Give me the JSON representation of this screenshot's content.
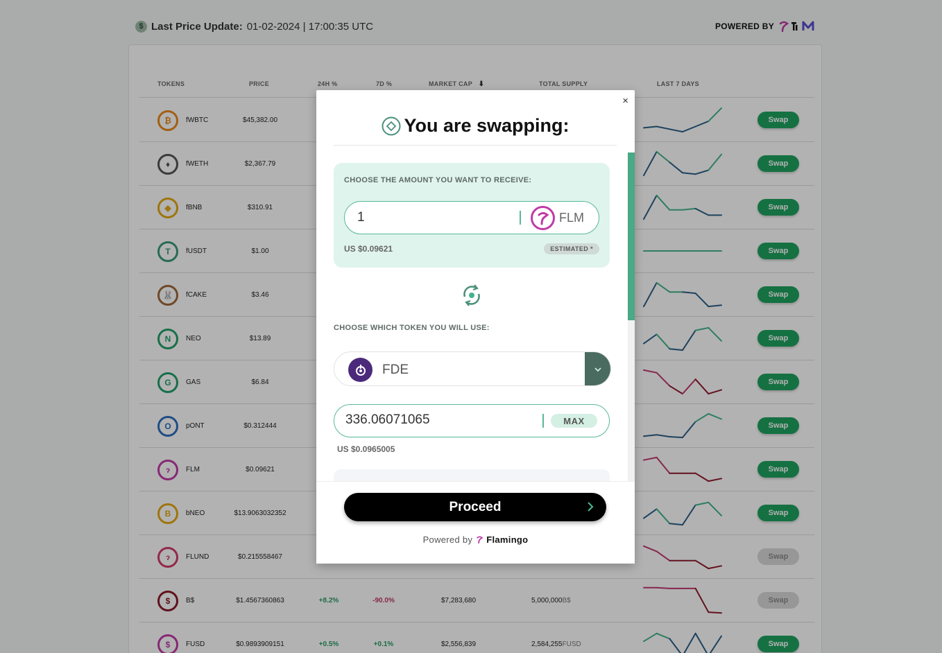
{
  "header": {
    "last_update_label": "Last Price Update:",
    "last_update_value": "01-02-2024 | 17:00:35 UTC",
    "powered_by": "POWERED BY"
  },
  "table": {
    "columns": [
      "TOKENS",
      "PRICE",
      "24H %",
      "7D %",
      "MARKET CAP",
      "TOTAL SUPPLY",
      "LAST 7 DAYS"
    ],
    "sort_indicator": "⬇",
    "swap_label": "Swap",
    "rows": [
      {
        "symbol": "fWBTC",
        "price": "$45,382.00",
        "h24": "",
        "d7": "",
        "mcap": "",
        "supply": "",
        "supply_unit": "",
        "icon": "bitcoin-icon",
        "glyph": "₿",
        "color": "#e8891c",
        "spark": [
          0.8,
          0.75,
          0.85,
          0.95,
          0.75,
          0.55,
          0.05
        ],
        "spark_colors": [
          "#2b5f87",
          "#2b5f87",
          "#2b5f87",
          "#2b5f87",
          "#2b5f87",
          "#43b38a"
        ],
        "swap_enabled": true
      },
      {
        "symbol": "fWETH",
        "price": "$2,367.79",
        "h24": "",
        "d7": "",
        "mcap": "",
        "supply": "",
        "supply_unit": "",
        "icon": "ethereum-icon",
        "glyph": "♦",
        "color": "#555555",
        "spark": [
          0.95,
          0.05,
          0.45,
          0.85,
          0.9,
          0.75,
          0.15
        ],
        "spark_colors": [
          "#2b5f87",
          "#43b38a",
          "#2b5f87",
          "#2b5f87",
          "#2b5f87",
          "#43b38a"
        ],
        "swap_enabled": true
      },
      {
        "symbol": "fBNB",
        "price": "$310.91",
        "h24": "",
        "d7": "",
        "mcap": "",
        "supply": "",
        "supply_unit": "",
        "icon": "bnb-icon",
        "glyph": "◆",
        "color": "#e3a815",
        "spark": [
          0.95,
          0.05,
          0.6,
          0.6,
          0.55,
          0.8,
          0.8
        ],
        "spark_colors": [
          "#2b5f87",
          "#43b38a",
          "#43b38a",
          "#43b38a",
          "#2b5f87",
          "#2b5f87"
        ],
        "swap_enabled": true
      },
      {
        "symbol": "fUSDT",
        "price": "$1.00",
        "h24": "",
        "d7": "",
        "mcap": "",
        "supply": "",
        "supply_unit": "",
        "icon": "usdt-icon",
        "glyph": "T",
        "color": "#3a9a7a",
        "spark": [
          0.5,
          0.5,
          0.5,
          0.5,
          0.5,
          0.5,
          0.5
        ],
        "spark_colors": [
          "#43b38a",
          "#43b38a",
          "#43b38a",
          "#43b38a",
          "#43b38a",
          "#43b38a"
        ],
        "swap_enabled": true
      },
      {
        "symbol": "fCAKE",
        "price": "$3.46",
        "h24": "",
        "d7": "",
        "mcap": "",
        "supply": "",
        "supply_unit": "",
        "icon": "cake-icon",
        "glyph": "🐰",
        "color": "#a0683a",
        "spark": [
          0.95,
          0.05,
          0.4,
          0.4,
          0.45,
          0.95,
          0.9
        ],
        "spark_colors": [
          "#2b5f87",
          "#43b38a",
          "#43b38a",
          "#2b5f87",
          "#2b5f87",
          "#2b5f87"
        ],
        "swap_enabled": true
      },
      {
        "symbol": "NEO",
        "price": "$13.89",
        "h24": "",
        "d7": "",
        "mcap": "",
        "supply": "",
        "supply_unit": "",
        "icon": "neo-icon",
        "glyph": "N",
        "color": "#21a06a",
        "spark": [
          0.7,
          0.35,
          0.9,
          0.95,
          0.2,
          0.1,
          0.6
        ],
        "spark_colors": [
          "#2b5f87",
          "#43b38a",
          "#2b5f87",
          "#2b5f87",
          "#43b38a",
          "#43b38a"
        ],
        "swap_enabled": true
      },
      {
        "symbol": "GAS",
        "price": "$6.84",
        "h24": "",
        "d7": "",
        "mcap": "",
        "supply": "",
        "supply_unit": "",
        "icon": "gas-icon",
        "glyph": "G",
        "color": "#21a06a",
        "spark": [
          0.05,
          0.15,
          0.65,
          0.95,
          0.4,
          0.95,
          0.8
        ],
        "spark_colors": [
          "#c0396e",
          "#c0396e",
          "#8e1a2a",
          "#c0396e",
          "#8e1a2a",
          "#8e1a2a"
        ],
        "swap_enabled": true
      },
      {
        "symbol": "pONT",
        "price": "$0.312444",
        "h24": "",
        "d7": "",
        "mcap": "",
        "supply": "",
        "supply_unit": "",
        "icon": "ont-icon",
        "glyph": "O",
        "color": "#2e6ec0",
        "spark": [
          0.9,
          0.85,
          0.92,
          0.95,
          0.35,
          0.05,
          0.25
        ],
        "spark_colors": [
          "#2b5f87",
          "#2b5f87",
          "#2b5f87",
          "#2b5f87",
          "#43b38a",
          "#43b38a"
        ],
        "swap_enabled": true
      },
      {
        "symbol": "FLM",
        "price": "$0.09621",
        "h24": "",
        "d7": "",
        "mcap": "",
        "supply": "",
        "supply_unit": "",
        "icon": "flamingo-icon",
        "glyph": "ɂ",
        "color": "#c03aa6",
        "spark": [
          0.15,
          0.05,
          0.65,
          0.65,
          0.65,
          0.95,
          0.85
        ],
        "spark_colors": [
          "#c0396e",
          "#c0396e",
          "#8e1a2a",
          "#8e1a2a",
          "#8e1a2a",
          "#8e1a2a"
        ],
        "swap_enabled": true
      },
      {
        "symbol": "bNEO",
        "price": "$13.9063032352",
        "h24": "",
        "d7": "",
        "mcap": "",
        "supply": "",
        "supply_unit": "",
        "icon": "bneo-icon",
        "glyph": "B",
        "color": "#e3a815",
        "spark": [
          0.7,
          0.35,
          0.9,
          0.95,
          0.2,
          0.1,
          0.6
        ],
        "spark_colors": [
          "#2b5f87",
          "#43b38a",
          "#2b5f87",
          "#2b5f87",
          "#43b38a",
          "#43b38a"
        ],
        "swap_enabled": true
      },
      {
        "symbol": "FLUND",
        "price": "$0.215558467",
        "h24": "",
        "d7": "",
        "mcap": "",
        "supply": "",
        "supply_unit": "",
        "icon": "flund-icon",
        "glyph": "ɂ",
        "color": "#d33a6a",
        "spark": [
          0.1,
          0.3,
          0.65,
          0.65,
          0.65,
          0.95,
          0.85
        ],
        "spark_colors": [
          "#c0396e",
          "#c0396e",
          "#8e1a2a",
          "#8e1a2a",
          "#8e1a2a",
          "#8e1a2a"
        ],
        "swap_enabled": false
      },
      {
        "symbol": "B$",
        "price": "$1.4567360863",
        "h24": "+8.2%",
        "d7": "-90.0%",
        "mcap": "$7,283,680",
        "supply": "5,000,000",
        "supply_unit": "B$",
        "icon": "bdollar-icon",
        "glyph": "$",
        "color": "#8a1a2a",
        "spark": [
          0.02,
          0.02,
          0.05,
          0.05,
          0.05,
          0.95,
          0.98
        ],
        "spark_colors": [
          "#c0396e",
          "#c0396e",
          "#c0396e",
          "#c0396e",
          "#8e1a2a",
          "#8e1a2a"
        ],
        "swap_enabled": false
      },
      {
        "symbol": "FUSD",
        "price": "$0.9893909151",
        "h24": "+0.5%",
        "d7": "+0.1%",
        "mcap": "$2,556,839",
        "supply": "2,584,255",
        "supply_unit": "FUSD",
        "icon": "fusd-icon",
        "glyph": "$",
        "color": "#c03aa6",
        "spark": [
          0.4,
          0.1,
          0.3,
          0.95,
          0.1,
          0.95,
          0.2
        ],
        "spark_colors": [
          "#43b38a",
          "#43b38a",
          "#2b5f87",
          "#2b5f87",
          "#2b5f87",
          "#2b5f87"
        ],
        "swap_enabled": true
      }
    ]
  },
  "modal": {
    "title": "You are swapping:",
    "close": "×",
    "receive_label": "CHOOSE THE AMOUNT YOU WANT TO RECEIVE:",
    "receive_amount": "1",
    "receive_token": "FLM",
    "receive_usd": "US $0.09621",
    "estimated": "ESTIMATED *",
    "use_label": "CHOOSE WHICH TOKEN YOU WILL USE:",
    "use_token": "FDE",
    "use_amount": "336.06071065",
    "max_label": "MAX",
    "use_usd": "US $0.0965005",
    "proceed": "Proceed",
    "powered_by": "Powered by",
    "powered_brand": "Flamingo"
  },
  "colors": {
    "accent_green": "#1fa35f",
    "teal": "#58b897",
    "flamingo_pink": "#c03aa6",
    "positive": "#2a9a63",
    "negative": "#c0396e"
  }
}
